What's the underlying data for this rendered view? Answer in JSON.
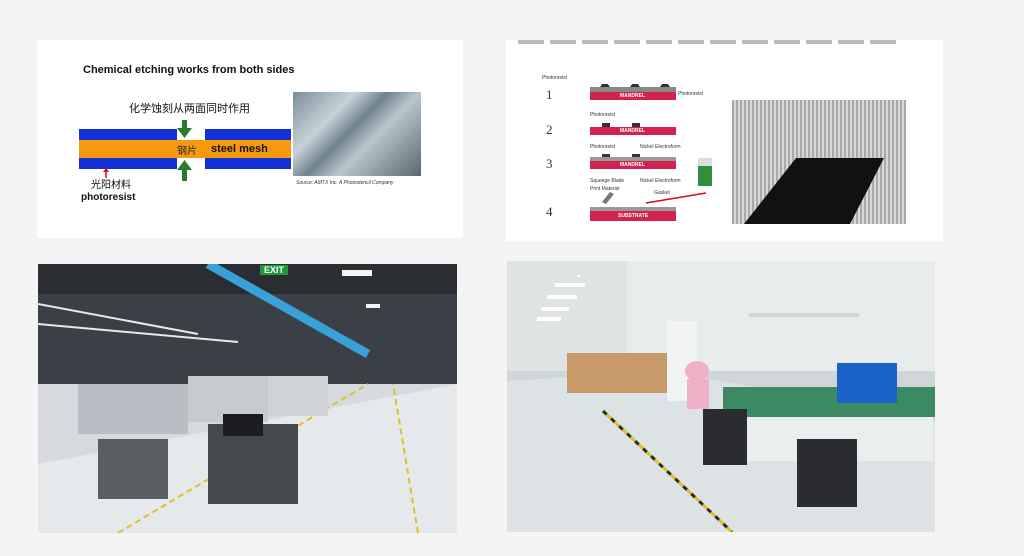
{
  "etching": {
    "title": "Chemical etching works from both sides",
    "cn_caption": "化学蚀刻从两面同时作用",
    "steel_cn": "钢片",
    "steel_en": "steel mesh",
    "photoresist_cn": "光阳材料",
    "photoresist_en": "photoresist",
    "source": "Source: AMTX Inc. A Photostencil Company"
  },
  "process": {
    "top_label": "Photoresist",
    "right_label": "Photoresist",
    "steps": [
      {
        "num": "1",
        "base": "MANDREL"
      },
      {
        "num": "2",
        "base": "MANDREL",
        "label1": "Photoresist"
      },
      {
        "num": "3",
        "base": "MANDREL",
        "label1": "Photoresist",
        "label2": "Nickel Electroform"
      },
      {
        "num": "4",
        "base": "SUBSTRATE",
        "label1": "Squeege Blade",
        "label2": "Print Material",
        "label3": "Nickel Electroform",
        "label4": "Gasket"
      }
    ]
  },
  "factory": {
    "exit_sign": "EXIT"
  }
}
